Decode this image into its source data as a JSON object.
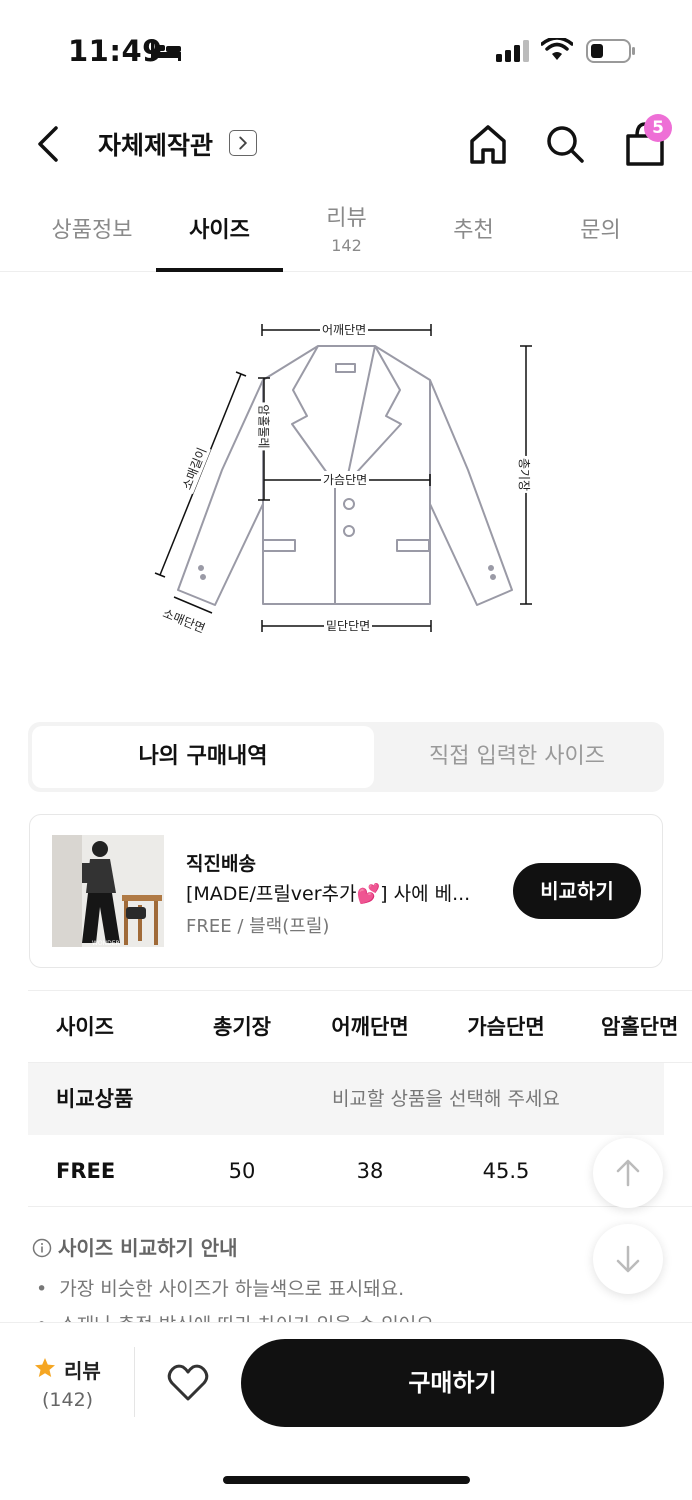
{
  "status_bar": {
    "time": "11:49"
  },
  "header": {
    "title": "자체제작관",
    "cart_count": "5"
  },
  "tabs": [
    {
      "label": "상품정보"
    },
    {
      "label": "사이즈"
    },
    {
      "label": "리뷰",
      "sub": "142"
    },
    {
      "label": "추천"
    },
    {
      "label": "문의"
    }
  ],
  "diagram": {
    "shoulder": "어깨단면",
    "armhole": "암홀둘레",
    "chest": "가슴단면",
    "sleeve": "소매길이",
    "cuff": "소매단면",
    "hem": "밑단단면",
    "length": "총기장"
  },
  "segment": {
    "active": "나의 구매내역",
    "inactive": "직접 입력한 사이즈"
  },
  "order": {
    "shipping": "직진배송",
    "name": "[MADE/프릴ver추가💕] 사에 베...",
    "option": "FREE / 블랙(프릴)",
    "thumb_caption": "WONDER",
    "compare_button": "비교하기"
  },
  "size_table": {
    "headers": [
      "사이즈",
      "총기장",
      "어깨단면",
      "가슴단면",
      "암홀단면"
    ],
    "compare_row": {
      "label": "비교상품",
      "message": "비교할 상품을 선택해 주세요"
    },
    "rows": [
      {
        "size": "FREE",
        "values": [
          "50",
          "38",
          "45.5"
        ]
      }
    ]
  },
  "guide": {
    "title": "사이즈 비교하기 안내",
    "items": [
      "가장 비슷한 사이즈가 하늘색으로 표시돼요.",
      "소재나 측정 방식에 따라 차이가 있을 수 있어요."
    ]
  },
  "bottom": {
    "review_label": "리뷰",
    "review_count": "(142)",
    "buy_button": "구매하기"
  },
  "colors": {
    "badge": "#ee6fd6",
    "star": "#f5a623",
    "primary": "#111111"
  }
}
